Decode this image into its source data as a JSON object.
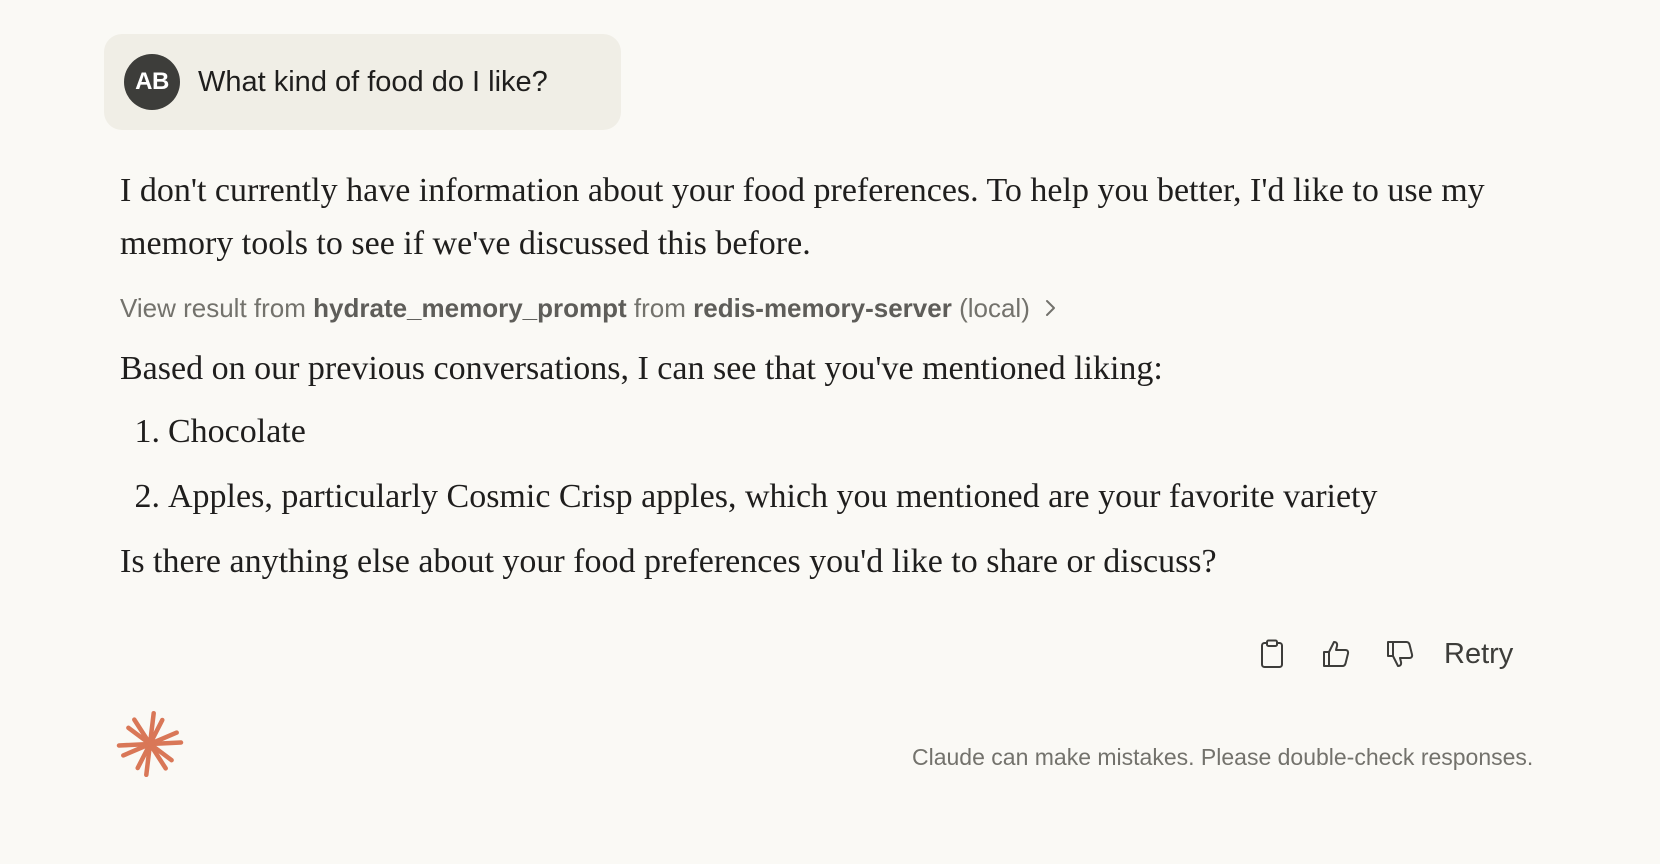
{
  "user_message": {
    "avatar_initials": "AB",
    "text": "What kind of food do I like?"
  },
  "assistant_message": {
    "paragraph_1": "I don't currently have information about your food preferences. To help you better, I'd like to use my memory tools to see if we've discussed this before.",
    "tool_result": {
      "prefix": "View result from ",
      "tool_name": "hydrate_memory_prompt",
      "middle": " from ",
      "server_name": "redis-memory-server",
      "suffix": " (local)",
      "icon": "chevron-right-icon"
    },
    "paragraph_2": "Based on our previous conversations, I can see that you've mentioned liking:",
    "list": [
      {
        "num": "1.",
        "text": "Chocolate"
      },
      {
        "num": "2.",
        "text": "Apples, particularly Cosmic Crisp apples, which you mentioned are your favorite variety"
      }
    ],
    "paragraph_3": "Is there anything else about your food preferences you'd like to share or discuss?"
  },
  "actions": {
    "copy_icon": "clipboard-icon",
    "thumbs_up_icon": "thumbs-up-icon",
    "thumbs_down_icon": "thumbs-down-icon",
    "retry_label": "Retry"
  },
  "footer": {
    "logo_icon": "claude-logo-icon",
    "logo_color": "#d97757",
    "disclaimer": "Claude can make mistakes. Please double-check responses."
  },
  "colors": {
    "background": "#faf9f5",
    "user_bubble": "#f0eee6",
    "avatar": "#3d3d3a",
    "muted_text": "#73726c"
  }
}
